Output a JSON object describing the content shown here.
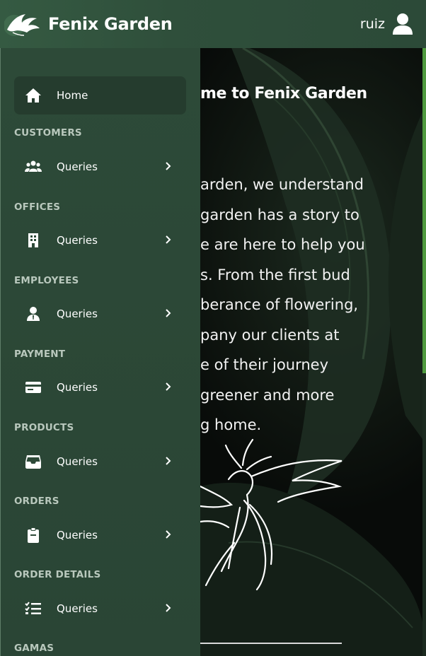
{
  "header": {
    "brand": "Fenix Garden",
    "user": "ruiz"
  },
  "main": {
    "welcome": "me to Fenix Garden",
    "intro_lines": [
      "arden, we understand",
      " garden has a story to",
      "e are here to help you",
      "s. From the first bud",
      "berance of flowering,",
      "pany our clients at",
      "e of their journey",
      "greener and more",
      "g home."
    ]
  },
  "sidebar": {
    "home": {
      "label": "Home",
      "icon": "home-icon"
    },
    "sections": [
      {
        "title": "CUSTOMERS",
        "item": "Queries",
        "icon": "users-icon"
      },
      {
        "title": "OFFICES",
        "item": "Queries",
        "icon": "building-icon"
      },
      {
        "title": "EMPLOYEES",
        "item": "Queries",
        "icon": "employee-icon"
      },
      {
        "title": "PAYMENT",
        "item": "Queries",
        "icon": "credit-card-icon"
      },
      {
        "title": "PRODUCTS",
        "item": "Queries",
        "icon": "inbox-icon"
      },
      {
        "title": "ORDERS",
        "item": "Queries",
        "icon": "clipboard-icon"
      },
      {
        "title": "ORDER DETAILS",
        "item": "Queries",
        "icon": "checklist-icon"
      },
      {
        "title": "GAMAS",
        "item": "",
        "icon": ""
      }
    ]
  },
  "colors": {
    "sidebar": "#2d4a38",
    "home_active": "#253c2e",
    "accent_scrollbar": "#4f9a3f"
  }
}
